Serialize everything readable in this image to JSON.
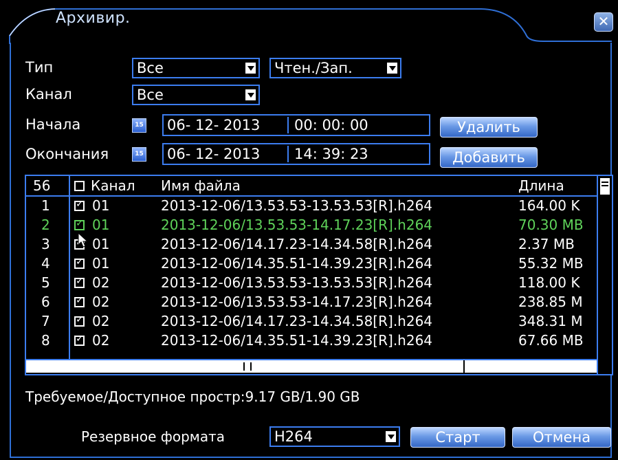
{
  "window": {
    "title": "Архивир.",
    "close_glyph": "✕"
  },
  "filters": {
    "type_label": "Тип",
    "type_value": "Все",
    "mode_value": "Чтен./Зап.",
    "channel_label": "Канал",
    "channel_value": "Все",
    "start_label": "Начала",
    "start_date": "06- 12- 2013",
    "start_time": "00: 00: 00",
    "end_label": "Окончания",
    "end_date": "06- 12- 2013",
    "end_time": "14: 39: 23",
    "calendar_icon": "calendar-icon"
  },
  "buttons": {
    "delete": "Удалить",
    "add": "Добавить",
    "start": "Старт",
    "cancel": "Отмена"
  },
  "table": {
    "count": "56",
    "col_channel": "Канал",
    "col_filename": "Имя файла",
    "col_length": "Длина",
    "selected_row": 1,
    "rows": [
      {
        "num": "1",
        "checked": true,
        "channel": "01",
        "file": "2013-12-06/13.53.53-13.53.53[R].h264",
        "length": "164.00 K"
      },
      {
        "num": "2",
        "checked": true,
        "channel": "01",
        "file": "2013-12-06/13.53.53-14.17.23[R].h264",
        "length": "70.30 MB"
      },
      {
        "num": "3",
        "checked": true,
        "channel": "01",
        "file": "2013-12-06/14.17.23-14.34.58[R].h264",
        "length": "2.37 MB"
      },
      {
        "num": "4",
        "checked": true,
        "channel": "01",
        "file": "2013-12-06/14.35.51-14.39.23[R].h264",
        "length": "55.32 MB"
      },
      {
        "num": "5",
        "checked": true,
        "channel": "02",
        "file": "2013-12-06/13.53.53-13.53.53[R].h264",
        "length": "118.00 K"
      },
      {
        "num": "6",
        "checked": true,
        "channel": "02",
        "file": "2013-12-06/13.53.53-14.17.23[R].h264",
        "length": "238.85 M"
      },
      {
        "num": "7",
        "checked": true,
        "channel": "02",
        "file": "2013-12-06/14.17.23-14.34.58[R].h264",
        "length": "348.31 M"
      },
      {
        "num": "8",
        "checked": true,
        "channel": "02",
        "file": "2013-12-06/14.35.51-14.39.23[R].h264",
        "length": "67.66 MB"
      }
    ]
  },
  "space": {
    "text": "Требуемое/Доступное простр:9.17 GB/1.90 GB"
  },
  "backup": {
    "label": "Резервное формата",
    "format_value": "H264"
  },
  "colors": {
    "accent": "#3c7df0",
    "selected_row": "#5fd35a",
    "background": "#000000"
  }
}
